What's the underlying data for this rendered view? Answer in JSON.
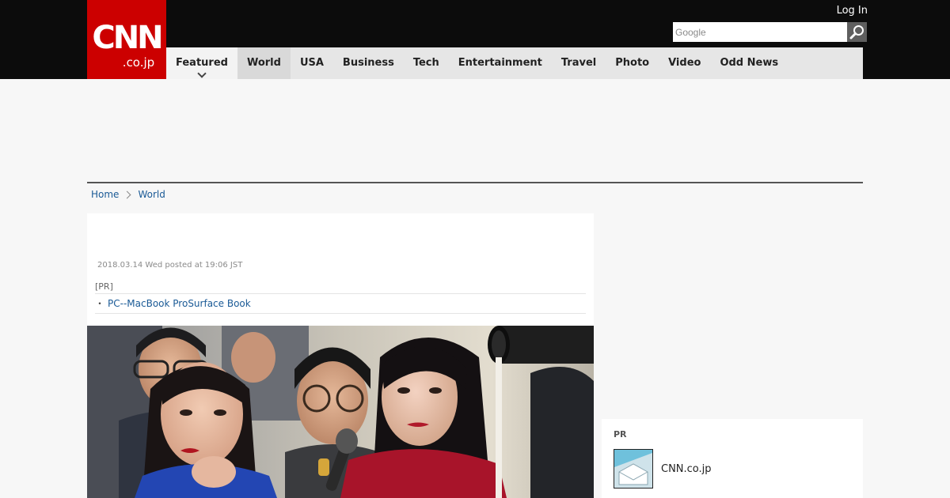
{
  "header": {
    "logo": {
      "main": "CNN",
      "sub": ".co.jp"
    },
    "login_label": "Log In",
    "search": {
      "placeholder": "Google",
      "value": ""
    },
    "nav": [
      {
        "label": "Featured"
      },
      {
        "label": "World"
      },
      {
        "label": "USA"
      },
      {
        "label": "Business"
      },
      {
        "label": "Tech"
      },
      {
        "label": "Entertainment"
      },
      {
        "label": "Travel"
      },
      {
        "label": "Photo"
      },
      {
        "label": "Video"
      },
      {
        "label": "Odd News"
      }
    ],
    "colors": {
      "brand": "#cc0000",
      "topbar": "#0c0c0c",
      "nav_bg": "#e6e6e6"
    }
  },
  "breadcrumb": [
    {
      "label": "Home"
    },
    {
      "label": "World"
    }
  ],
  "article": {
    "posted": "2018.03.14 Wed posted at 19:06 JST",
    "pr_tag": "[PR]",
    "pr_bullet": "・",
    "pr_link": "PC--MacBook ProSurface Book",
    "photo_icon": "press-photo"
  },
  "sidebar": {
    "pr_title": "PR",
    "item": {
      "name": "CNN.co.jp",
      "icon": "envelope-thumbnail-icon"
    }
  }
}
